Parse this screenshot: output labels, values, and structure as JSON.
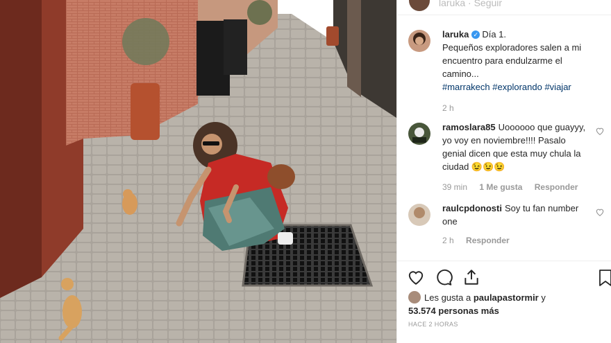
{
  "header": {
    "username_partial": "laruka · Seguir"
  },
  "caption": {
    "username": "laruka",
    "verified": true,
    "text": "Día 1.\nPequeños exploradores salen a mi encuentro para endulzarme el camino...",
    "hashtags": [
      "#marrakech",
      "#explorando",
      "#viajar"
    ],
    "time": "2 h"
  },
  "comments": [
    {
      "username": "ramoslara85",
      "text": "Uoooooo que guayyy, yo voy en noviembre!!!! Pasalo genial dicen que esta muy chula la ciudad 😉😉😉",
      "time": "39 min",
      "likes": "1 Me gusta",
      "reply": "Responder"
    },
    {
      "username": "raulcpdonosti",
      "text": "Soy tu fan number one",
      "time": "2 h",
      "reply": "Responder"
    }
  ],
  "likes": {
    "prefix": "Les gusta a ",
    "user": "paulapastormir",
    "mid": " y",
    "count": "53.574 personas más"
  },
  "timestamp": "HACE 2 HORAS",
  "colors": {
    "link": "#003569",
    "verified": "#3897f0",
    "muted": "#999999"
  },
  "icons": [
    "heart-icon",
    "comment-icon",
    "share-icon",
    "save-icon"
  ]
}
